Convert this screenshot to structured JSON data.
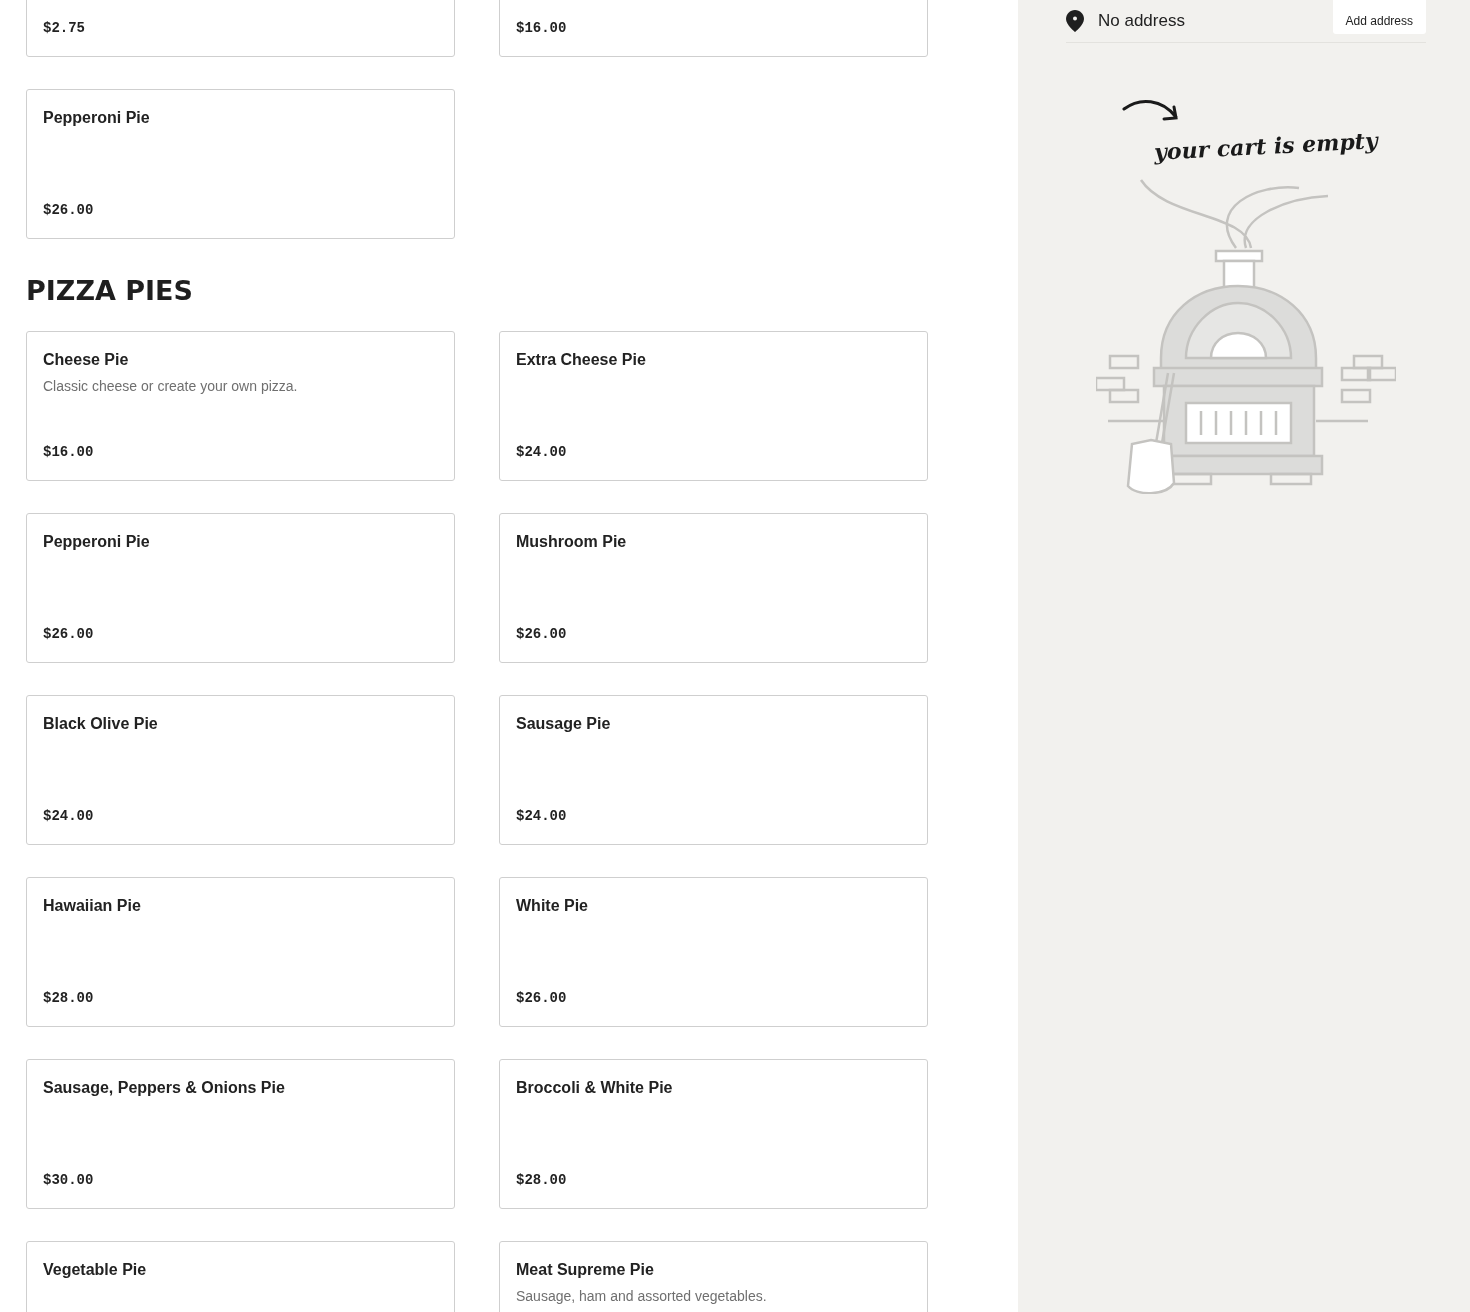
{
  "menu_sections": [
    {
      "items": [
        {
          "price": "$2.75"
        },
        {
          "price": "$16.00"
        },
        {
          "name": "Pepperoni Pie",
          "price": "$26.00"
        }
      ]
    },
    {
      "title": "PIZZA PIES",
      "items": [
        {
          "name": "Cheese Pie",
          "description": "Classic cheese or create your own pizza.",
          "price": "$16.00"
        },
        {
          "name": "Extra Cheese Pie",
          "price": "$24.00"
        },
        {
          "name": "Pepperoni Pie",
          "price": "$26.00"
        },
        {
          "name": "Mushroom Pie",
          "price": "$26.00"
        },
        {
          "name": "Black Olive Pie",
          "price": "$24.00"
        },
        {
          "name": "Sausage Pie",
          "price": "$24.00"
        },
        {
          "name": "Hawaiian Pie",
          "price": "$28.00"
        },
        {
          "name": "White Pie",
          "price": "$26.00"
        },
        {
          "name": "Sausage, Peppers & Onions Pie",
          "price": "$30.00"
        },
        {
          "name": "Broccoli & White Pie",
          "price": "$28.00"
        },
        {
          "name": "Vegetable Pie"
        },
        {
          "name": "Meat Supreme Pie",
          "description": "Sausage, ham and assorted vegetables."
        }
      ]
    }
  ],
  "cart": {
    "address": "No address",
    "add_address_button": "Add address",
    "empty_message": "your cart is empty"
  }
}
